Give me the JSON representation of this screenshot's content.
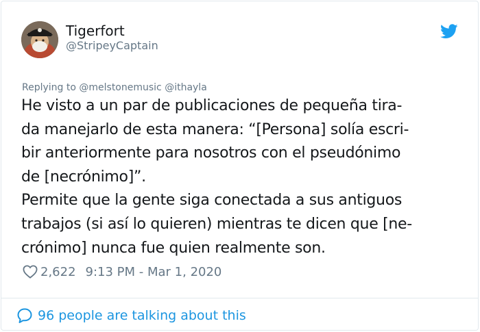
{
  "user": {
    "name": "Tigerfort",
    "handle": "@StripeyCaptain"
  },
  "replying_to": "Replying to @melstonemusic @ithayla",
  "tweet_lines": [
    "He visto a un par de publicaciones de pequeña tira-",
    "da manejarlo de esta manera: “[Persona] solía escri-",
    "bir anteriormente para nosotros  con el pseudónimo",
    "de [necrónimo]”.",
    "Permite que la gente siga conectada a sus antiguos",
    "trabajos (si así lo quieren) mientras te dicen que [ne-",
    "crónimo] nunca fue quien realmente son."
  ],
  "stats": {
    "likes": "2,622",
    "timestamp": "9:13 PM - Mar 1, 2020"
  },
  "footer": {
    "talking": "96 people are talking about this"
  },
  "icons": {
    "bird": "twitter-bird-icon",
    "heart": "heart-outline-icon",
    "bubble": "speech-bubble-icon"
  },
  "colors": {
    "brand_blue": "#1da1f2",
    "link_blue": "#1b95e0",
    "muted": "#657786",
    "text": "#14171a",
    "border": "#e1e8ed"
  }
}
